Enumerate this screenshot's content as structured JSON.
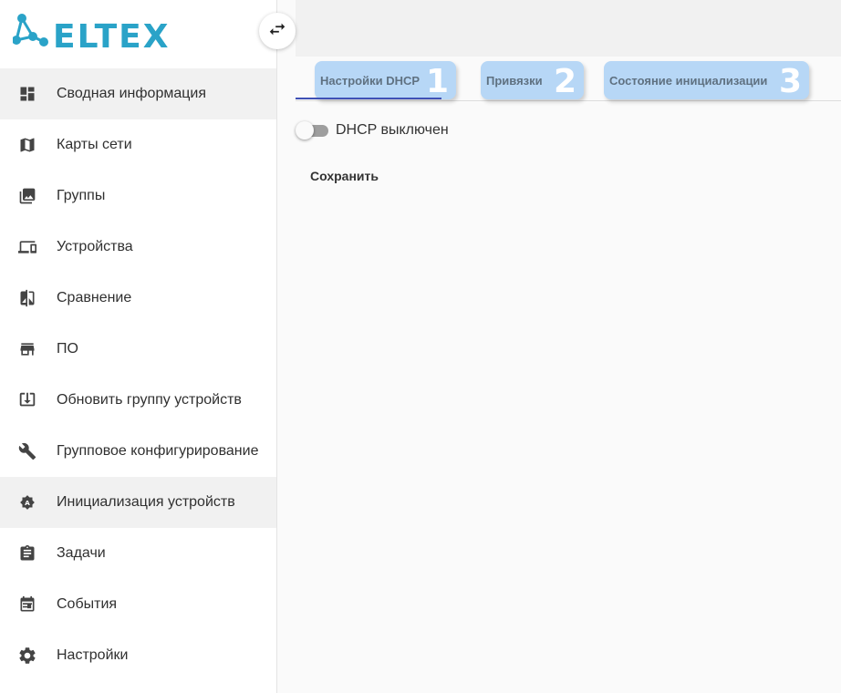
{
  "logo": {
    "text": "ELTEX",
    "color": "#2aa3c8"
  },
  "collapse_icon": "swap-horizontal-icon",
  "sidebar": {
    "items": [
      {
        "label": "Сводная информация",
        "icon": "dashboard-icon",
        "active": true
      },
      {
        "label": "Карты сети",
        "icon": "map-icon",
        "active": false
      },
      {
        "label": "Группы",
        "icon": "photo-library-icon",
        "active": false
      },
      {
        "label": "Устройства",
        "icon": "devices-icon",
        "active": false
      },
      {
        "label": "Сравнение",
        "icon": "compare-icon",
        "active": false
      },
      {
        "label": "ПО",
        "icon": "store-icon",
        "active": false
      },
      {
        "label": "Обновить группу устройств",
        "icon": "download-box-icon",
        "active": false
      },
      {
        "label": "Групповое конфигурирование",
        "icon": "wrench-icon",
        "active": false
      },
      {
        "label": "Инициализация устройств",
        "icon": "auto-badge-icon",
        "active": true
      },
      {
        "label": "Задачи",
        "icon": "clipboard-icon",
        "active": false
      },
      {
        "label": "События",
        "icon": "calendar-icon",
        "active": false
      },
      {
        "label": "Настройки",
        "icon": "gear-icon",
        "active": false
      }
    ]
  },
  "tabs": [
    {
      "label": "Настройки DHCP",
      "number": "1",
      "selected": true
    },
    {
      "label": "Привязки",
      "number": "2",
      "selected": false
    },
    {
      "label": "Состояние инициализации",
      "number": "3",
      "selected": false
    }
  ],
  "dhcp": {
    "toggle_label": "DHCP выключен",
    "enabled": false
  },
  "actions": {
    "save_label": "Сохранить"
  },
  "colors": {
    "accent": "#3f51b5",
    "tab_highlight": "#b7d7f6"
  }
}
